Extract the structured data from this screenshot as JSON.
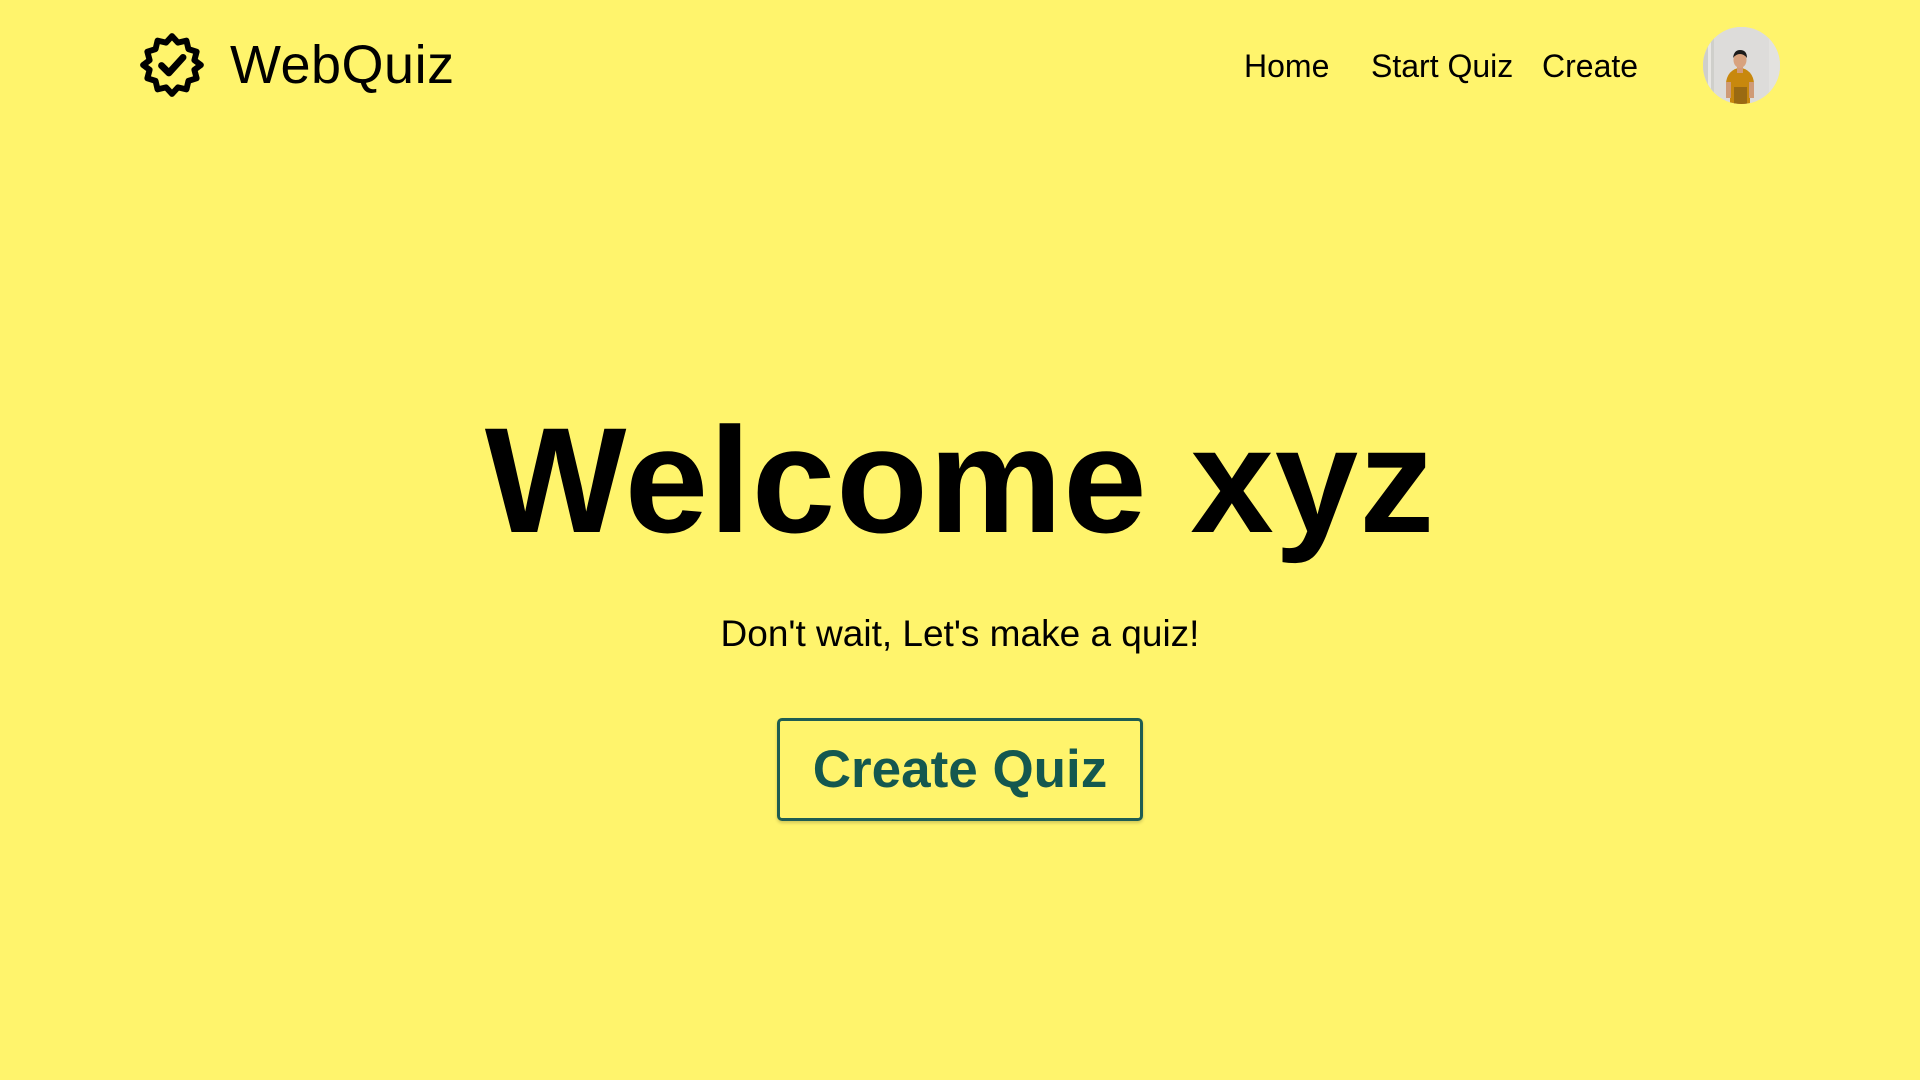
{
  "navbar": {
    "brand_name": "WebQuiz",
    "brand_icon": "badge-check-icon",
    "links": [
      {
        "label": "Home"
      },
      {
        "label": "Start Quiz"
      },
      {
        "label": "Create"
      }
    ],
    "avatar_icon": "user-avatar"
  },
  "hero": {
    "title": "Welcome xyz",
    "subtitle": "Don't wait, Let's make a quiz!",
    "cta_label": "Create Quiz"
  },
  "colors": {
    "background": "#fff46c",
    "text": "#000000",
    "cta_border": "#1f5d52",
    "cta_text": "#14584f"
  }
}
